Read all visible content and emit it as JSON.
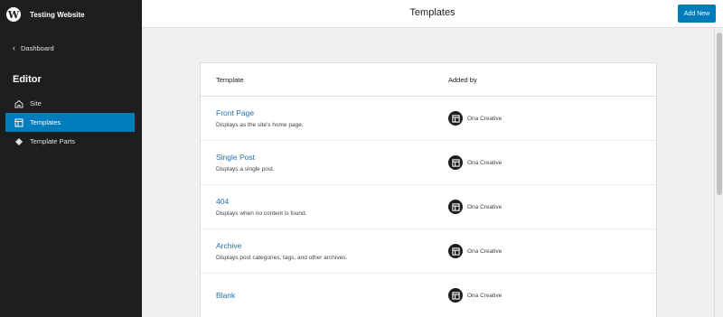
{
  "sidebar": {
    "site_name": "Testing Website",
    "dashboard_label": "Dashboard",
    "editor_title": "Editor",
    "items": [
      {
        "label": "Site",
        "icon": "home-icon"
      },
      {
        "label": "Templates",
        "icon": "layout-icon",
        "active": true
      },
      {
        "label": "Template Parts",
        "icon": "diamond-icon"
      }
    ]
  },
  "header": {
    "title": "Templates",
    "add_new_label": "Add New"
  },
  "table": {
    "columns": [
      "Template",
      "Added by"
    ],
    "rows": [
      {
        "name": "Front Page",
        "description": "Displays as the site's home page.",
        "author": "Ona Creative"
      },
      {
        "name": "Single Post",
        "description": "Displays a single post.",
        "author": "Ona Creative"
      },
      {
        "name": "404",
        "description": "Displays when no content is found.",
        "author": "Ona Creative"
      },
      {
        "name": "Archive",
        "description": "Displays post categories, tags, and other archives.",
        "author": "Ona Creative"
      },
      {
        "name": "Blank",
        "description": "",
        "author": "Ona Creative"
      }
    ]
  },
  "colors": {
    "accent": "#007cba",
    "sidebar_bg": "#1e1e1e",
    "link": "#2271b1"
  }
}
